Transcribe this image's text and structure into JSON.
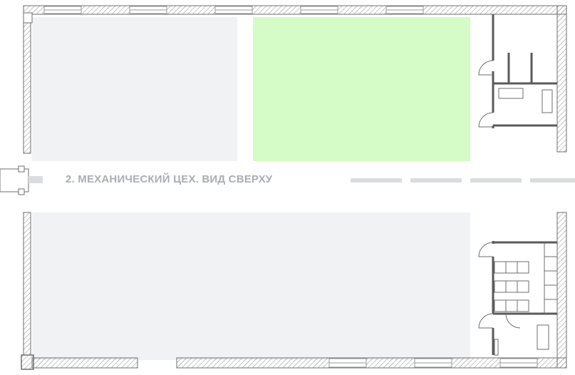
{
  "plan": {
    "title": "2. МЕХАНИЧЕСКИЙ ЦЕХ. ВИД СВЕРХУ",
    "colors": {
      "wall_hatch": "#8a8a8a",
      "wall_stroke": "#6e6e6e",
      "partition": "#5a5a5a",
      "zone_gray": "#f1f2f4",
      "zone_selected": "#d5fcc7",
      "dashes": "#d9dde0",
      "window": "#9a9a9a"
    },
    "zones": [
      {
        "name": "zone-upper-left",
        "selected": false
      },
      {
        "name": "zone-upper-middle",
        "selected": true
      },
      {
        "name": "zone-lower",
        "selected": false
      }
    ]
  }
}
